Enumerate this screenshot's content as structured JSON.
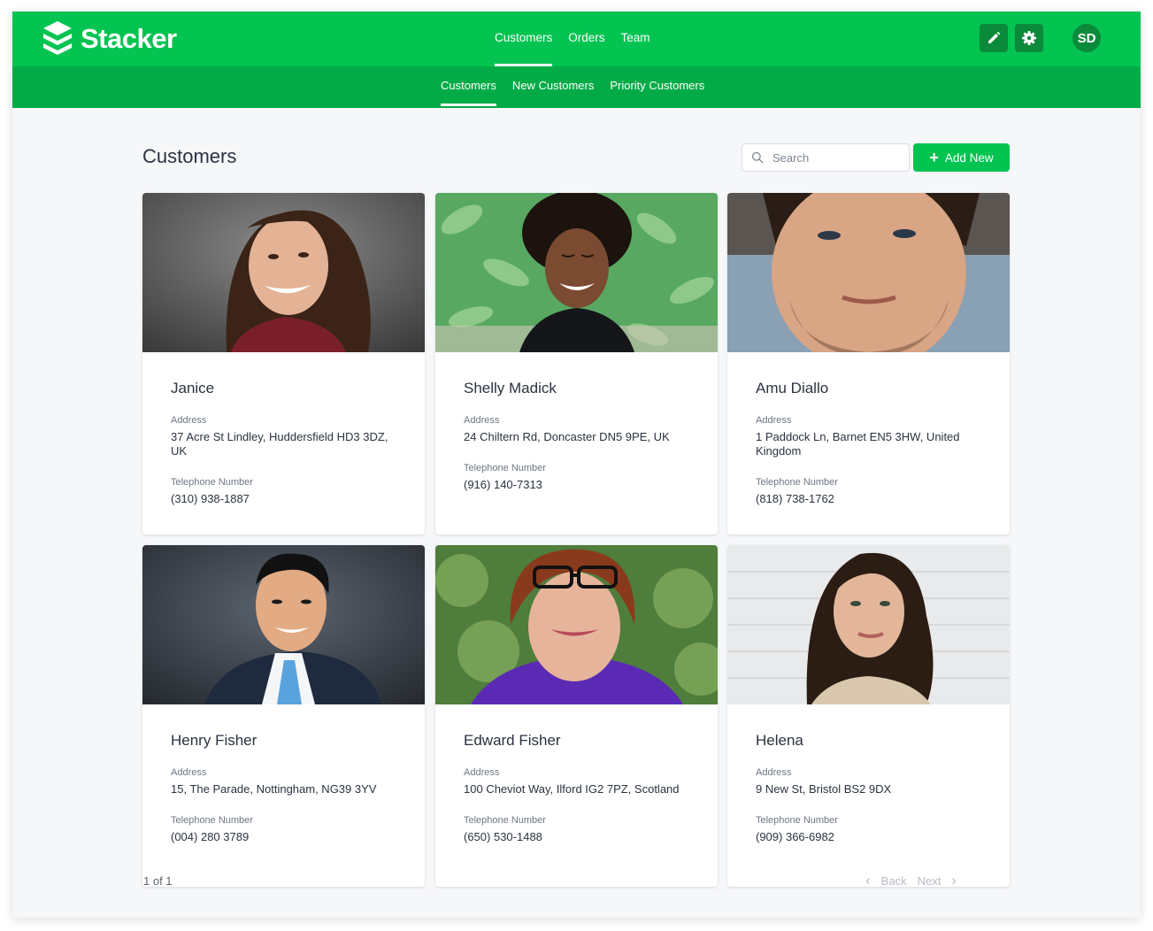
{
  "app": {
    "name": "Stacker"
  },
  "main_nav": [
    {
      "label": "Customers",
      "active": true
    },
    {
      "label": "Orders",
      "active": false
    },
    {
      "label": "Team",
      "active": false
    }
  ],
  "toolbar": {
    "edit_icon": "pencil-icon",
    "settings_icon": "gear-icon",
    "user_initials": "SD"
  },
  "sub_nav": [
    {
      "label": "Customers",
      "active": true
    },
    {
      "label": "New Customers",
      "active": false
    },
    {
      "label": "Priority Customers",
      "active": false
    }
  ],
  "page": {
    "title": "Customers",
    "search_placeholder": "Search",
    "add_label": "Add New"
  },
  "customers": [
    {
      "name": "Janice",
      "address_label": "Address",
      "address": "37 Acre St Lindley, Huddersfield HD3 3DZ, UK",
      "phone_label": "Telephone Number",
      "phone": "(310) 938-1887"
    },
    {
      "name": "Shelly Madick",
      "address_label": "Address",
      "address": "24 Chiltern Rd, Doncaster DN5 9PE, UK",
      "phone_label": "Telephone Number",
      "phone": "(916) 140-7313"
    },
    {
      "name": "Amu Diallo",
      "address_label": "Address",
      "address": "1 Paddock Ln, Barnet EN5 3HW, United Kingdom",
      "phone_label": "Telephone Number",
      "phone": "(818) 738-1762"
    },
    {
      "name": "Henry Fisher",
      "address_label": "Address",
      "address": "15, The Parade, Nottingham, NG39 3YV",
      "phone_label": "Telephone Number",
      "phone": "(004) 280 3789"
    },
    {
      "name": "Edward Fisher",
      "address_label": "Address",
      "address": "100 Cheviot Way, Ilford IG2 7PZ, Scotland",
      "phone_label": "Telephone Number",
      "phone": "(650) 530-1488"
    },
    {
      "name": "Helena",
      "address_label": "Address",
      "address": "9 New St, Bristol BS2 9DX",
      "phone_label": "Telephone Number",
      "phone": "(909) 366-6982"
    }
  ],
  "pagination": {
    "summary": "1 of 1",
    "back_label": "Back",
    "next_label": "Next"
  },
  "colors": {
    "brand": "#03c351",
    "subnav": "#03ab46",
    "button_dark": "#0a8a3a"
  }
}
